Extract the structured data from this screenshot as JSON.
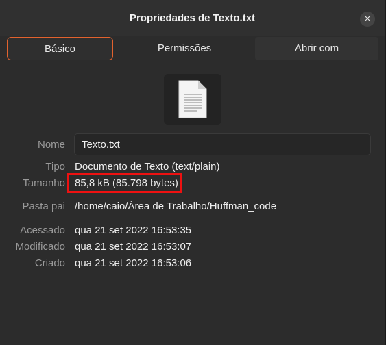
{
  "window": {
    "title": "Propriedades de Texto.txt",
    "close_label": "×"
  },
  "tabs": [
    {
      "label": "Básico",
      "active": true
    },
    {
      "label": "Permissões",
      "active": false
    },
    {
      "label": "Abrir com",
      "active": false
    }
  ],
  "file_icon": "text-document-icon",
  "fields": {
    "name": {
      "label": "Nome",
      "value": "Texto.txt"
    },
    "type": {
      "label": "Tipo",
      "value": "Documento de Texto (text/plain)"
    },
    "size": {
      "label": "Tamanho",
      "value": "85,8 kB (85.798 bytes)"
    },
    "parent": {
      "label": "Pasta pai",
      "value": "/home/caio/Área de Trabalho/Huffman_code"
    },
    "accessed": {
      "label": "Acessado",
      "value": "qua 21 set 2022 16:53:35"
    },
    "modified": {
      "label": "Modificado",
      "value": "qua 21 set 2022 16:53:07"
    },
    "created": {
      "label": "Criado",
      "value": "qua 21 set 2022 16:53:06"
    }
  },
  "colors": {
    "accent": "#e2622e",
    "highlight_annotation": "#ee1111",
    "background": "#2c2c2c"
  }
}
